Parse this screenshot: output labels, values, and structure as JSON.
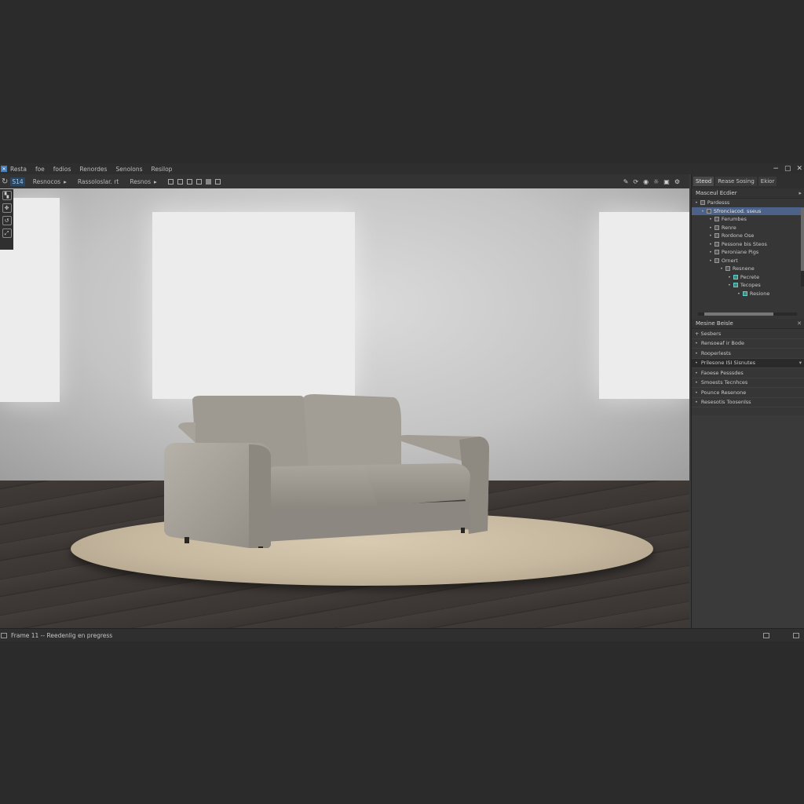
{
  "menu": {
    "items": [
      "Resta",
      "foe",
      "fodios",
      "Renordes",
      "Senolons",
      "Resilop"
    ],
    "window_controls": [
      "−",
      "▢",
      "✕"
    ]
  },
  "toolbar": {
    "frame_value": "S14",
    "dropdowns": [
      "Resnocos",
      "Rassoloslar. rt",
      "Resnos"
    ],
    "dropdown_arrow": "▸"
  },
  "right_panel": {
    "tabs": [
      "Steod",
      "Rease Sosing",
      "Ekior"
    ],
    "outliner_title": "Masceul Ecdier",
    "outliner_items": [
      {
        "label": "Pardesss",
        "level": 0
      },
      {
        "label": "Sfronciacod. sseus",
        "level": 1
      },
      {
        "label": "Ferumbes",
        "level": 2
      },
      {
        "label": "Renre",
        "level": 2
      },
      {
        "label": "Rordone Ose",
        "level": 2
      },
      {
        "label": "Pessone bis Steos",
        "level": 2
      },
      {
        "label": "Peroniane Pigs",
        "level": 2
      },
      {
        "label": "Ornert",
        "level": 2
      },
      {
        "label": "Resnene",
        "level": 3
      },
      {
        "label": "Pecrete",
        "level": 4
      },
      {
        "label": "Tecopes",
        "level": 4
      },
      {
        "label": "Resione",
        "level": 5
      }
    ],
    "materials_title": "Mesine Beisle",
    "materials": [
      "+ Sesbers",
      "Rensoeaf ir Bode",
      "Rooperlests",
      "Prilesone ISI Sisnutes",
      "Faoese Pesssdes",
      "Smoests Tecnhces",
      "Pounce Resenone",
      "Resesotis Toosenlss"
    ]
  },
  "status": {
    "text": "Frame 11 -- Reedenlig en pregress"
  },
  "icons": {
    "close": "✕",
    "expand": "▸",
    "bullet": "•"
  },
  "colors": {
    "selection": "#4c6288",
    "accent": "#4a7fb8",
    "teal": "#3f8a7a"
  }
}
